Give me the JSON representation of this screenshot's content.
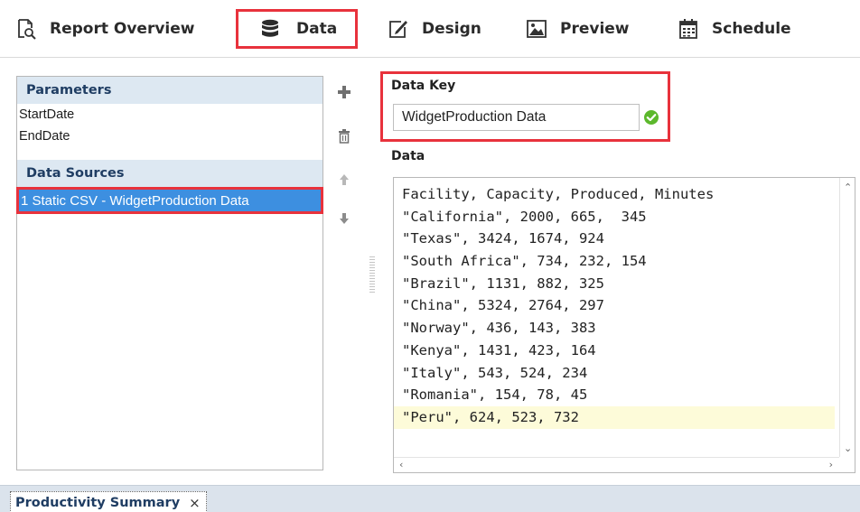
{
  "tabs": [
    {
      "label": "Report Overview",
      "icon": "report-overview-icon",
      "active": false
    },
    {
      "label": "Data",
      "icon": "database-icon",
      "active": true
    },
    {
      "label": "Design",
      "icon": "design-pencil-icon",
      "active": false
    },
    {
      "label": "Preview",
      "icon": "image-preview-icon",
      "active": false
    },
    {
      "label": "Schedule",
      "icon": "calendar-icon",
      "active": false
    }
  ],
  "left_panel": {
    "parameters_header": "Parameters",
    "parameters": [
      "StartDate",
      "EndDate"
    ],
    "data_sources_header": "Data Sources",
    "data_sources": [
      "1 Static CSV - WidgetProduction Data"
    ],
    "selected_data_source": "1 Static CSV - WidgetProduction Data"
  },
  "tools": [
    "add-icon",
    "delete-icon",
    "move-up-icon",
    "move-down-icon"
  ],
  "data_key": {
    "label": "Data Key",
    "value": "WidgetProduction Data",
    "status_icon": "check-circle-icon",
    "status_color": "#5cb82c"
  },
  "data_editor": {
    "label": "Data",
    "lines": [
      "Facility, Capacity, Produced, Minutes",
      "\"California\", 2000, 665,  345",
      "\"Texas\", 3424, 1674, 924",
      "\"South Africa\", 734, 232, 154",
      "\"Brazil\", 1131, 882, 325",
      "\"China\", 5324, 2764, 297",
      "\"Norway\", 436, 143, 383",
      "\"Kenya\", 1431, 423, 164",
      "\"Italy\", 543, 524, 234",
      "\"Romania\", 154, 78, 45",
      "\"Peru\", 624, 523, 732"
    ],
    "highlighted_line": 10
  },
  "bottom_tab": {
    "label": "Productivity Summary",
    "close": "×"
  },
  "colors": {
    "highlight_border": "#e8323c",
    "selection_bg": "#3d8fe0",
    "section_header_bg": "#dde8f2",
    "section_header_text": "#1f3d63",
    "current_line_bg": "#fdfbd9"
  }
}
